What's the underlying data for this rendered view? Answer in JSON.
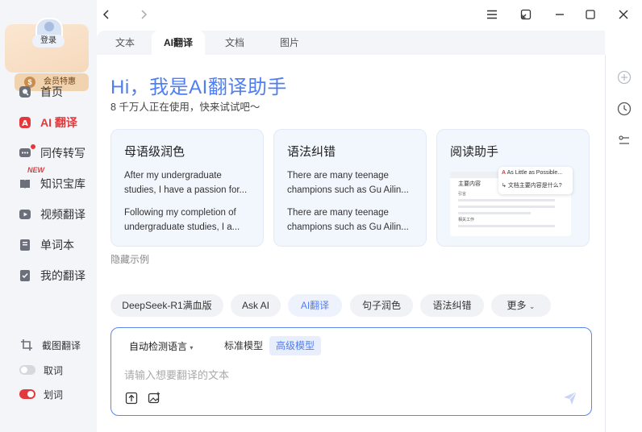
{
  "sidebar": {
    "login_label": "登录",
    "vip_label": "会员特惠",
    "items": [
      {
        "label": "首页",
        "icon": "home-icon"
      },
      {
        "label": "AI 翻译",
        "icon": "ai-translate-icon"
      },
      {
        "label": "同传转写",
        "icon": "interpret-icon"
      },
      {
        "label": "知识宝库",
        "icon": "knowledge-icon"
      },
      {
        "label": "视频翻译",
        "icon": "video-icon"
      },
      {
        "label": "单词本",
        "icon": "wordbook-icon"
      },
      {
        "label": "我的翻译",
        "icon": "my-translation-icon"
      }
    ],
    "new_badge": "NEW",
    "bottom": {
      "screenshot_translate": "截图翻译",
      "word_pick": "取词",
      "word_select": "划词"
    }
  },
  "tabs": [
    {
      "label": "文本"
    },
    {
      "label": "AI翻译"
    },
    {
      "label": "文档"
    },
    {
      "label": "图片"
    }
  ],
  "hero": {
    "title": "Hi，我是AI翻译助手",
    "subtitle": "8 千万人正在使用，快来试试吧～"
  },
  "cards": [
    {
      "title": "母语级润色",
      "text1": "After my undergraduate studies, I have a passion for...",
      "text2": "Following my completion of undergraduate studies, I a..."
    },
    {
      "title": "语法纠错",
      "text1": "There are many teenage champions such as Gu Ailin...",
      "text2": "There are many teenage champions such as Gu Ailin..."
    },
    {
      "title": "阅读助手",
      "popup_line1": "As Little as Possible...",
      "popup_line2": "文档主要内容是什么?",
      "doc_heading": "主要内容",
      "doc_line1": "引言",
      "doc_line2": "相关工作"
    }
  ],
  "hide_examples": "隐藏示例",
  "chips": [
    "DeepSeek-R1满血版",
    "Ask AI",
    "AI翻译",
    "句子润色",
    "语法纠错",
    "更多"
  ],
  "input": {
    "lang": "自动检测语言",
    "model_std": "标准模型",
    "model_adv": "高级模型",
    "placeholder": "请输入想要翻译的文本"
  },
  "colors": {
    "accent": "#4f7df2",
    "active_red": "#e4393c",
    "sidebar_bg": "#f4f5f9"
  }
}
